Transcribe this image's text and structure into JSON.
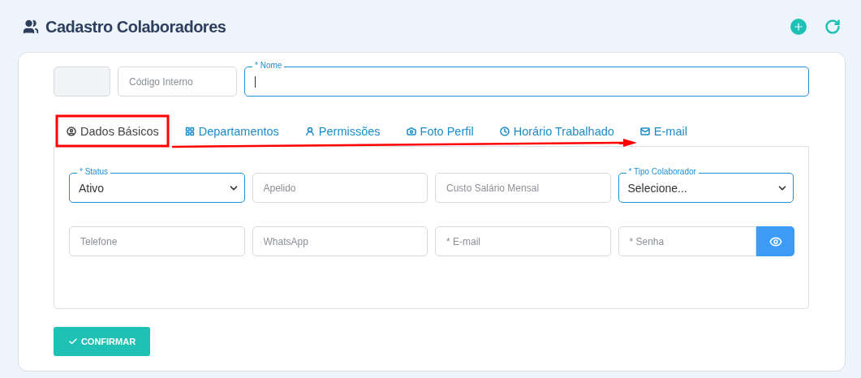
{
  "header": {
    "title": "Cadastro Colaboradores"
  },
  "top_fields": [
    {
      "kind": "blank"
    },
    {
      "kind": "input",
      "placeholder": "Código Interno"
    },
    {
      "kind": "focused",
      "label": "* Nome"
    }
  ],
  "tabs": [
    {
      "label": "Dados Básicos",
      "selected": true
    },
    {
      "label": "Departamentos",
      "selected": false
    },
    {
      "label": "Permissões",
      "selected": false
    },
    {
      "label": "Foto Perfil",
      "selected": false
    },
    {
      "label": "Horário Trabalhado",
      "selected": false
    },
    {
      "label": "E-mail",
      "selected": false
    }
  ],
  "fields": [
    {
      "kind": "select",
      "label": "* Status",
      "value": "Ativo"
    },
    {
      "kind": "input",
      "placeholder": "Apelido"
    },
    {
      "kind": "input",
      "placeholder": "Custo Salário Mensal"
    },
    {
      "kind": "select",
      "label": "* Tipo Colaborador",
      "value": "Selecione..."
    },
    {
      "kind": "input",
      "placeholder": "Telefone"
    },
    {
      "kind": "input",
      "placeholder": "WhatsApp"
    },
    {
      "kind": "input",
      "placeholder": "* E-mail"
    },
    {
      "kind": "password",
      "placeholder": "* Senha"
    }
  ],
  "confirm_button": {
    "label": "CONFIRMAR"
  }
}
